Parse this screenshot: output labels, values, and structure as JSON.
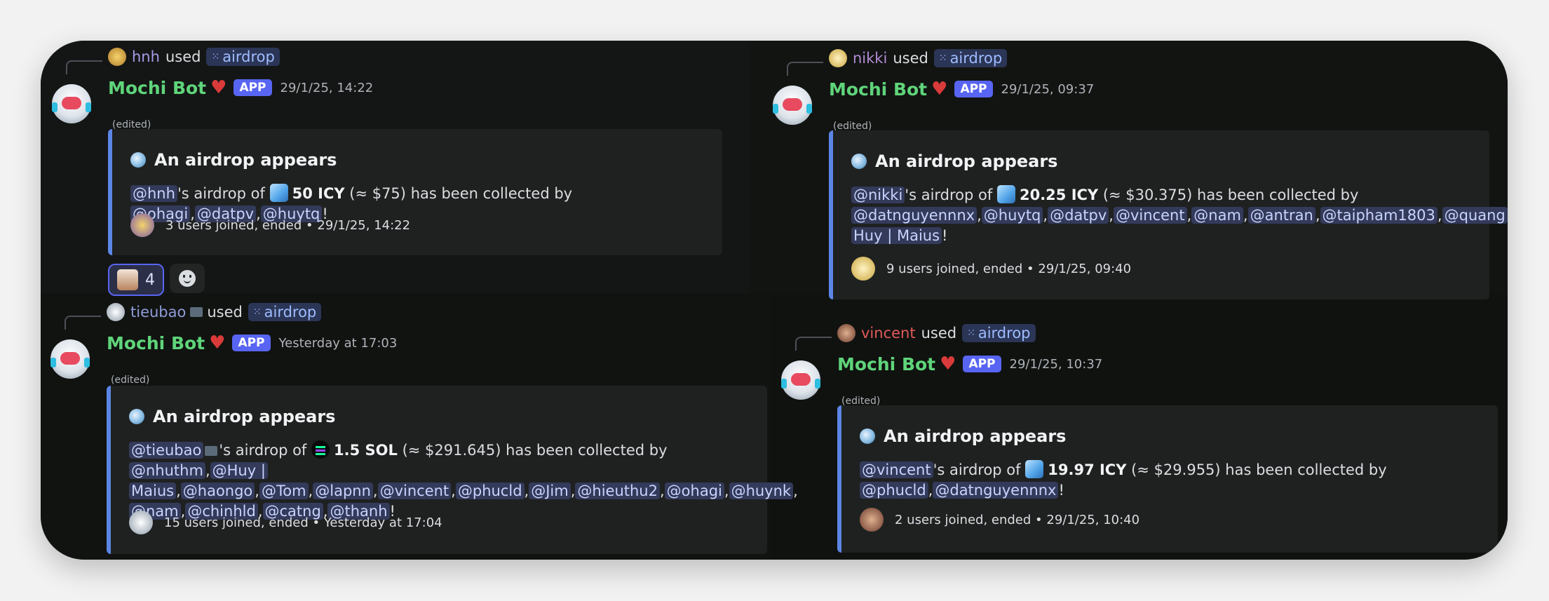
{
  "colors": {
    "accent": "#5865f2",
    "bot_name": "#5fd47a",
    "embed_border": "#5c86e5",
    "mention_bg": "#333a5a"
  },
  "bot": {
    "name": "Mochi Bot",
    "badge": "APP",
    "edited": "(edited)"
  },
  "embed_title": "An airdrop appears",
  "command": "airdrop",
  "used": "used",
  "messages": {
    "m1": {
      "user": "hnh",
      "user_color": "#a79be8",
      "timestamp": "29/1/25, 14:22",
      "owner": "@hnh",
      "amount": "50 ICY",
      "usd": "(≈ $75)",
      "mentions": [
        "@ohagi",
        "@datpv",
        "@huytq"
      ],
      "footer": "3 users joined, ended • 29/1/25, 14:22",
      "reaction_count": "4"
    },
    "m2": {
      "user": "nikki",
      "user_color": "#b28bd6",
      "timestamp": "29/1/25, 09:37",
      "owner": "@nikki",
      "amount": "20.25 ICY",
      "usd": "(≈ $30.375)",
      "mentions": [
        "@datnguyennnx",
        "@huytq",
        "@datpv",
        "@vincent",
        "@nam",
        "@antran",
        "@taipham1803",
        "@quang",
        "@",
        "Huy | Maius"
      ],
      "footer": "9 users joined, ended • 29/1/25, 09:40"
    },
    "m3": {
      "user": "tieubao",
      "user_color": "#8f9bd8",
      "timestamp": "Yesterday at 17:03",
      "owner": "@tieubao",
      "amount": "1.5 SOL",
      "usd": "(≈ $291.645)",
      "mentions": [
        "@nhuthm",
        "@Huy |",
        "Maius",
        "@haongo",
        "@Tom",
        "@lapnn",
        "@vincent",
        "@phucld",
        "@Jim",
        "@hieuthu2",
        "@ohagi",
        "@huynk",
        "@nam",
        "@chinhld",
        "@catng",
        "@thanh"
      ],
      "footer": "15 users joined, ended • Yesterday at 17:04"
    },
    "m4": {
      "user": "vincent",
      "user_color": "#e05a5a",
      "timestamp": "29/1/25, 10:37",
      "owner": "@vincent",
      "amount": "19.97 ICY",
      "usd": "(≈ $29.955)",
      "mentions": [
        "@phucld",
        "@datnguyennnx"
      ],
      "footer": "2 users joined, ended • 29/1/25, 10:40"
    }
  },
  "text": {
    "possessive": "'s airdrop of",
    "collected": "has been collected by",
    "sep": ",",
    "end": "!"
  }
}
